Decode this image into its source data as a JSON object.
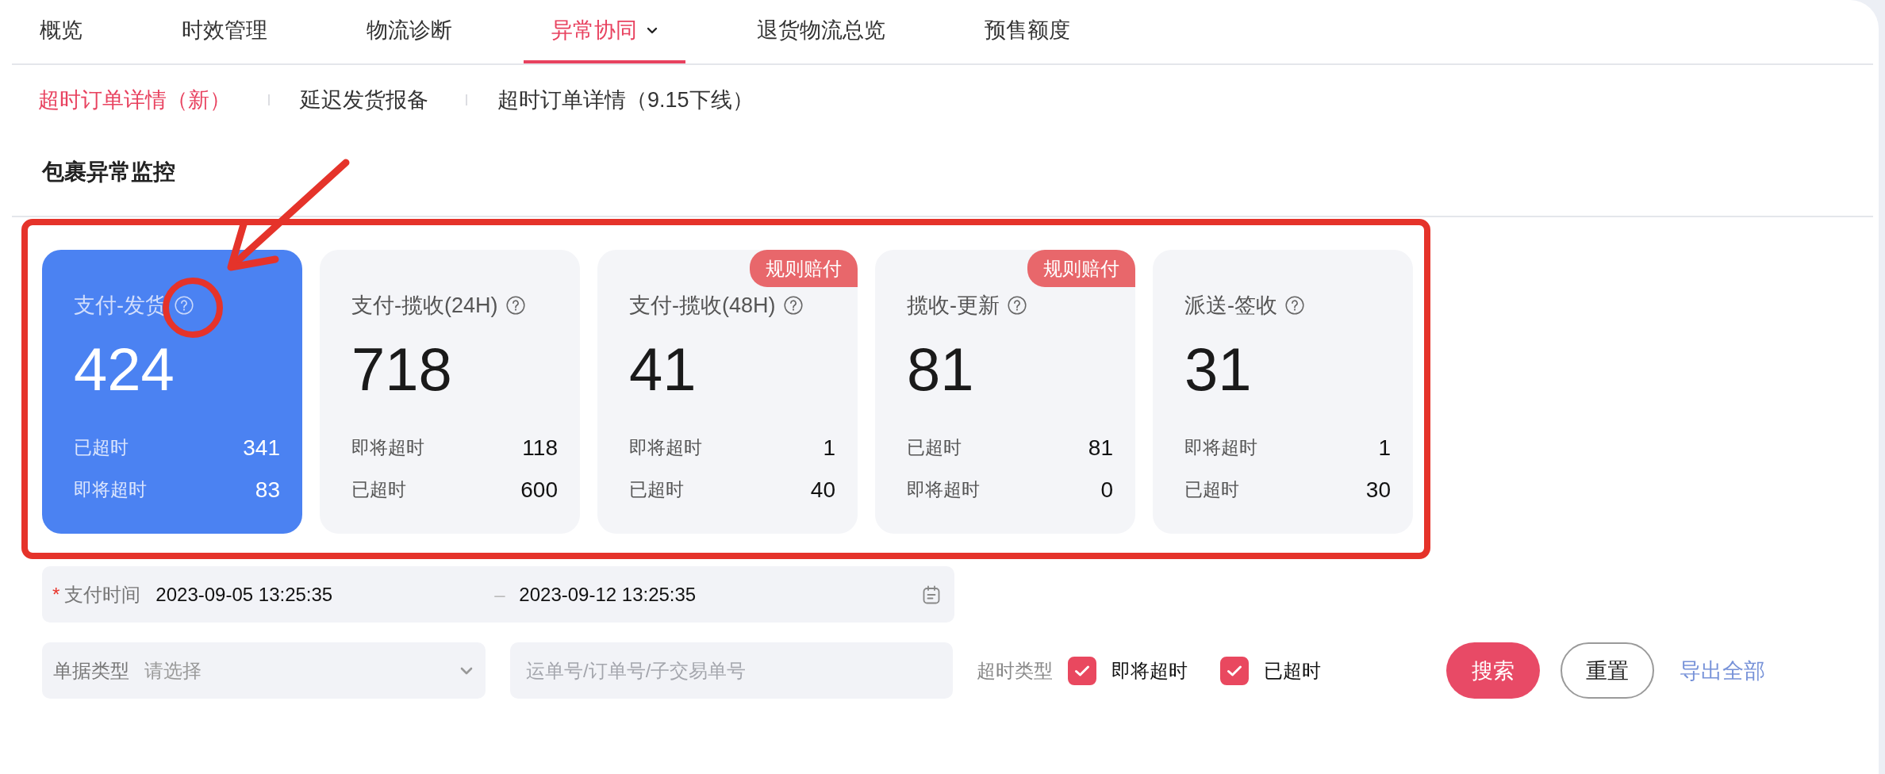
{
  "tabs": [
    {
      "label": "概览",
      "selected": false,
      "menu": false
    },
    {
      "label": "时效管理",
      "selected": false,
      "menu": false
    },
    {
      "label": "物流诊断",
      "selected": false,
      "menu": false
    },
    {
      "label": "异常协同",
      "selected": true,
      "menu": true
    },
    {
      "label": "退货物流总览",
      "selected": false,
      "menu": false
    },
    {
      "label": "预售额度",
      "selected": false,
      "menu": false
    }
  ],
  "subtabs": [
    {
      "label": "超时订单详情（新）",
      "selected": true
    },
    {
      "label": "延迟发货报备",
      "selected": false
    },
    {
      "label": "超时订单详情（9.15下线）",
      "selected": false
    }
  ],
  "section": {
    "title": "包裹异常监控"
  },
  "cards": [
    {
      "title": "支付-发货",
      "total": "424",
      "selected": true,
      "rows": [
        {
          "label": "已超时",
          "value": "341"
        },
        {
          "label": "即将超时",
          "value": "83"
        }
      ]
    },
    {
      "title": "支付-揽收(24H)",
      "total": "718",
      "selected": false,
      "rows": [
        {
          "label": "即将超时",
          "value": "118"
        },
        {
          "label": "已超时",
          "value": "600"
        }
      ]
    },
    {
      "title": "支付-揽收(48H)",
      "total": "41",
      "selected": false,
      "badge": "规则赔付",
      "rows": [
        {
          "label": "即将超时",
          "value": "1"
        },
        {
          "label": "已超时",
          "value": "40"
        }
      ]
    },
    {
      "title": "揽收-更新",
      "total": "81",
      "selected": false,
      "badge": "规则赔付",
      "rows": [
        {
          "label": "已超时",
          "value": "81"
        },
        {
          "label": "即将超时",
          "value": "0"
        }
      ]
    },
    {
      "title": "派送-签收",
      "total": "31",
      "selected": false,
      "rows": [
        {
          "label": "即将超时",
          "value": "1"
        },
        {
          "label": "已超时",
          "value": "30"
        }
      ]
    }
  ],
  "filters": {
    "date_range": {
      "label": "支付时间",
      "required": true,
      "required_mark": "*",
      "start": "2023-09-05 13:25:35",
      "separator": "–",
      "end": "2023-09-12 13:25:35"
    },
    "doc_type": {
      "label": "单据类型",
      "placeholder": "请选择"
    },
    "search": {
      "placeholder": "运单号/订单号/子交易单号"
    },
    "timeout_type": {
      "label": "超时类型",
      "options": [
        {
          "label": "即将超时",
          "checked": true
        },
        {
          "label": "已超时",
          "checked": true
        }
      ]
    },
    "buttons": [
      {
        "label": "搜索",
        "kind": "primary"
      },
      {
        "label": "重置",
        "kind": "secondary"
      },
      {
        "label": "导出全部",
        "kind": "link"
      }
    ]
  },
  "annotations": [
    {
      "kind": "frame"
    },
    {
      "kind": "arrow"
    },
    {
      "kind": "ring"
    }
  ]
}
